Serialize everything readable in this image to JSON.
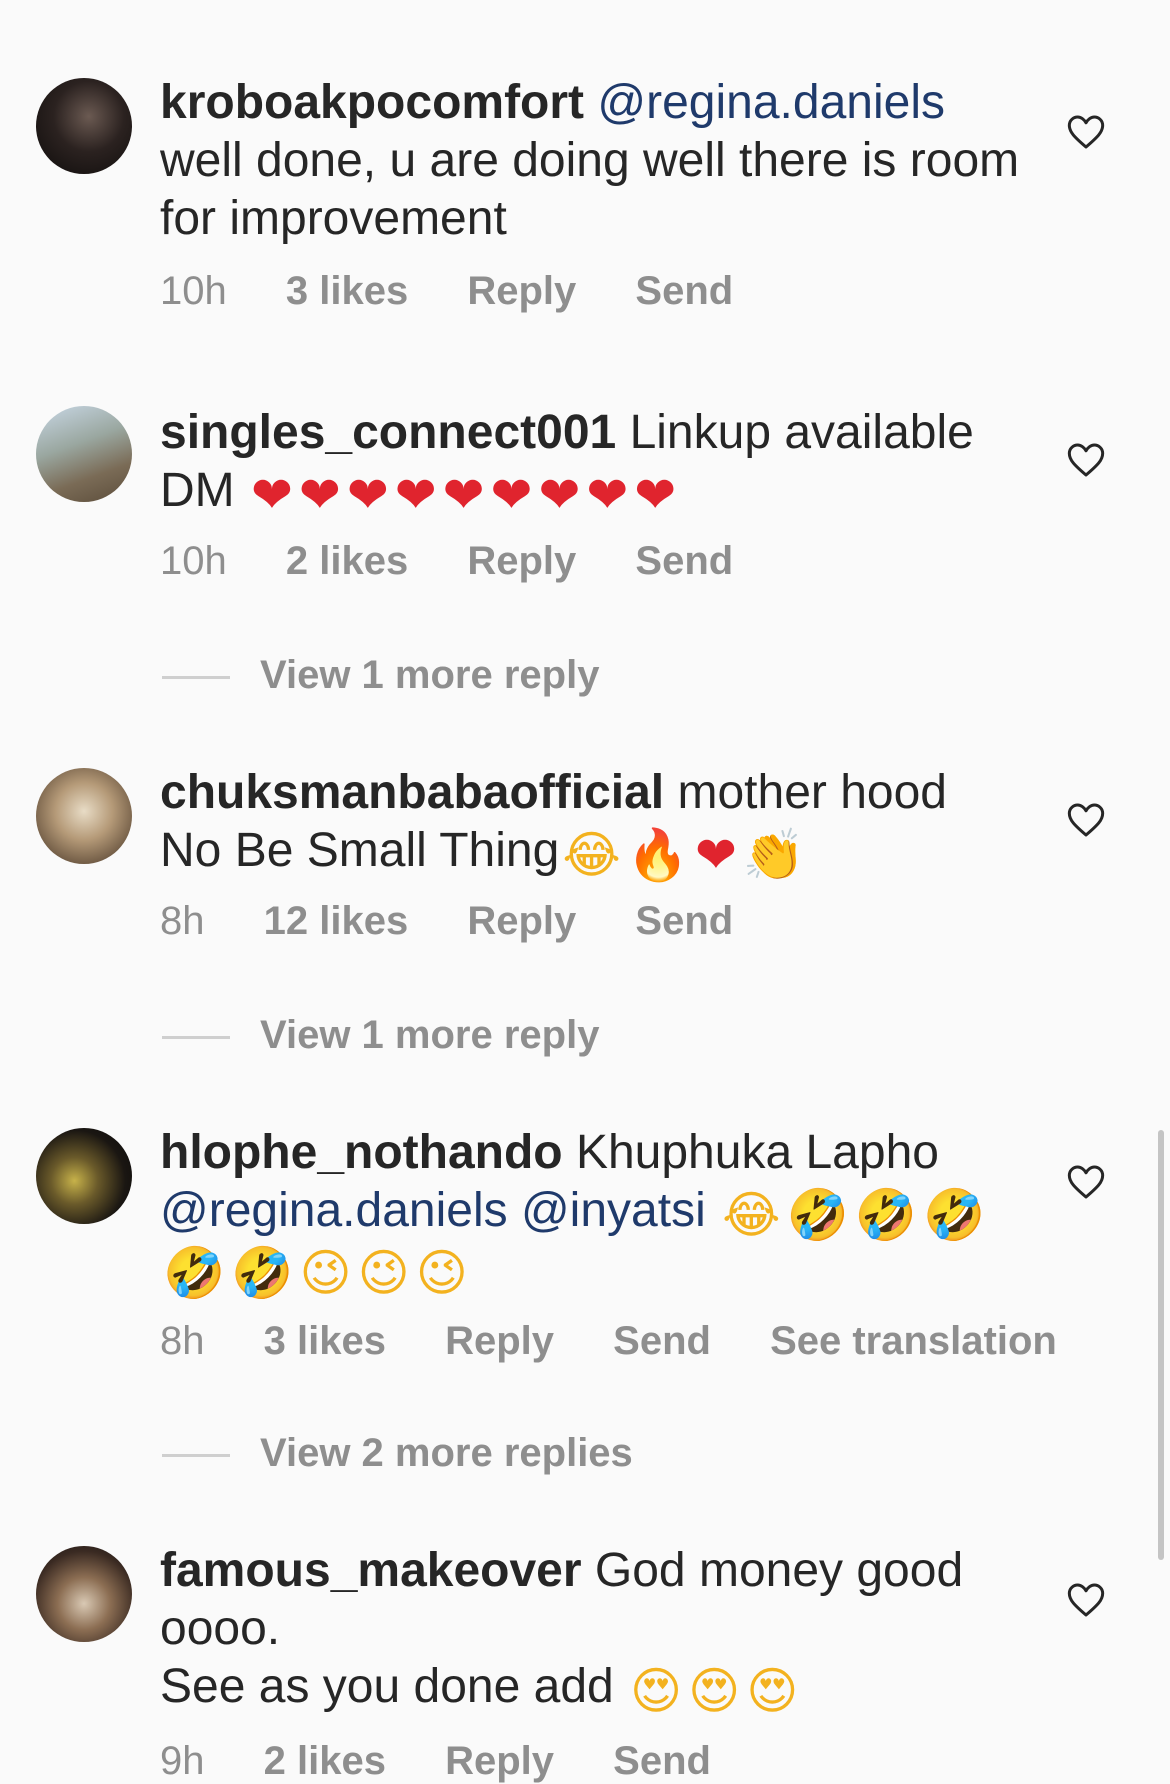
{
  "colors": {
    "background": "#fafafa",
    "text": "#262626",
    "meta": "#8e8e8e",
    "mention": "#1f3a6b"
  },
  "comments": [
    {
      "username": "kroboakpocomfort",
      "mention": "@regina.daniels",
      "text": "well done, u are doing well there is room for improvement",
      "time": "10h",
      "likes": "3 likes",
      "reply": "Reply",
      "send": "Send"
    },
    {
      "username": "singles_connect001",
      "text": "Linkup available DM",
      "emojis": [
        "❤",
        "❤",
        "❤",
        "❤",
        "❤",
        "❤",
        "❤",
        "❤",
        "❤"
      ],
      "time": "10h",
      "likes": "2 likes",
      "reply": "Reply",
      "send": "Send",
      "view_more": "View 1 more reply"
    },
    {
      "username": "chuksmanbabaofficial",
      "text": "mother hood No Be Small Thing",
      "emojis": [
        "😂",
        "🔥",
        "❤",
        "👏"
      ],
      "time": "8h",
      "likes": "12 likes",
      "reply": "Reply",
      "send": "Send",
      "view_more": "View 1 more reply"
    },
    {
      "username": "hlophe_nothando",
      "text": "Khuphuka Lapho",
      "mentions": [
        "@regina.daniels",
        "@inyatsi"
      ],
      "emojis_line1": [
        "😂",
        "🤣",
        "🤣",
        "🤣"
      ],
      "emojis_line2": [
        "🤣",
        "🤣",
        "😉",
        "😉",
        "😉"
      ],
      "time": "8h",
      "likes": "3 likes",
      "reply": "Reply",
      "send": "Send",
      "see_translation": "See translation",
      "view_more": "View 2 more replies"
    },
    {
      "username": "famous_makeover",
      "text": "God money good oooo.",
      "text_line2": "See as you done add",
      "emojis": [
        "😍",
        "😍",
        "😍"
      ],
      "time": "9h",
      "likes": "2 likes",
      "reply": "Reply",
      "send": "Send"
    }
  ]
}
